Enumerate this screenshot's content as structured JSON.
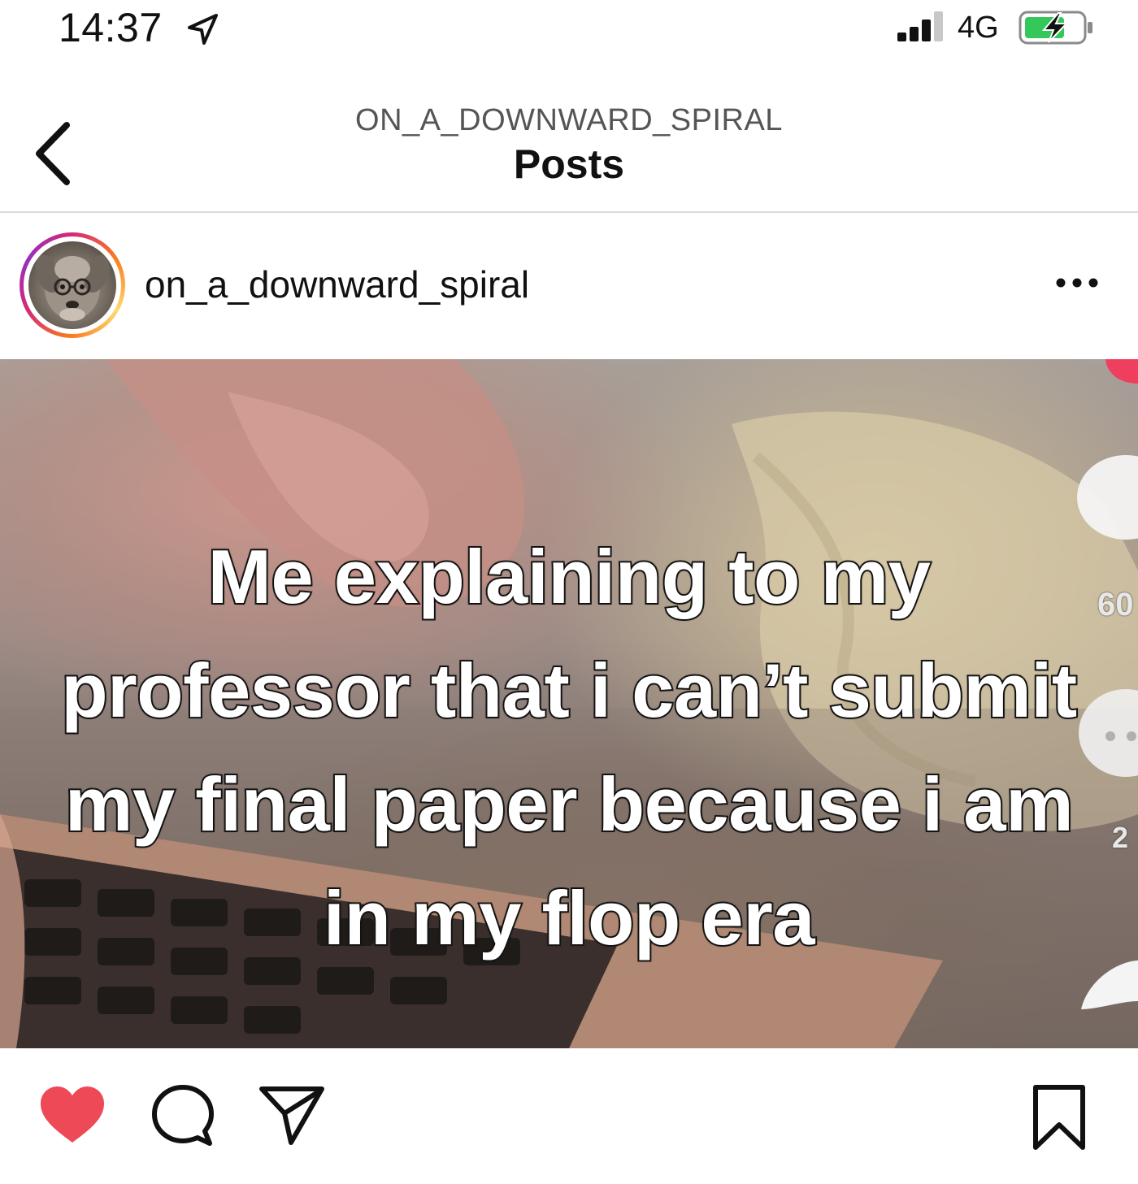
{
  "status_bar": {
    "time": "14:37",
    "network": "4G",
    "icons": [
      "location-arrow-icon",
      "signal-bars-icon",
      "battery-charging-icon"
    ]
  },
  "header": {
    "account": "ON_A_DOWNWARD_SPIRAL",
    "title": "Posts",
    "back_icon": "chevron-left-icon"
  },
  "post": {
    "username": "on_a_downward_spiral",
    "more_icon": "ellipsis-icon",
    "caption_lines": [
      "Me explaining to my",
      "professor that i can’t submit",
      "my final paper because i am",
      "in my flop era"
    ],
    "side_overlay": {
      "count_top": "60",
      "count_bottom": "2"
    },
    "actions": {
      "liked": true,
      "icons": [
        "heart-icon",
        "comment-bubble-icon",
        "paper-plane-icon",
        "bookmark-icon"
      ],
      "like_color": "#ed4956"
    }
  }
}
